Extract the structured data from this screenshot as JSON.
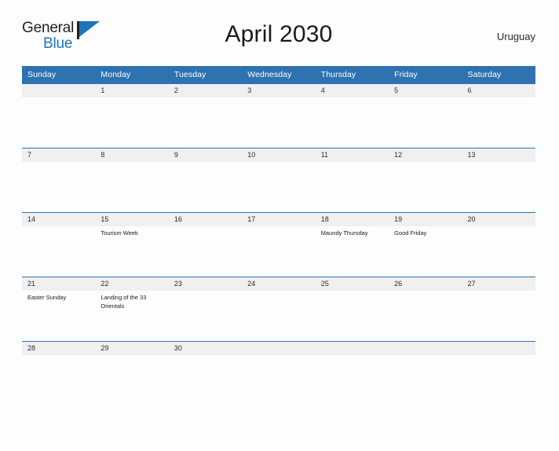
{
  "logo": {
    "line1": "General",
    "line2": "Blue",
    "flag_icon": "flag-triangle-icon",
    "color_dark": "#231f20",
    "color_blue": "#1b75bb"
  },
  "header": {
    "title": "April 2030",
    "country": "Uruguay"
  },
  "colors": {
    "header_blue": "#2e72b0",
    "daynum_band": "#f0f0f0",
    "page_background": "#fdfdfd",
    "text": "#1a1a1a"
  },
  "calendar": {
    "weekday_headers": [
      "Sunday",
      "Monday",
      "Tuesday",
      "Wednesday",
      "Thursday",
      "Friday",
      "Saturday"
    ],
    "weeks": [
      [
        {
          "day": "",
          "events": []
        },
        {
          "day": "1",
          "events": []
        },
        {
          "day": "2",
          "events": []
        },
        {
          "day": "3",
          "events": []
        },
        {
          "day": "4",
          "events": []
        },
        {
          "day": "5",
          "events": []
        },
        {
          "day": "6",
          "events": []
        }
      ],
      [
        {
          "day": "7",
          "events": []
        },
        {
          "day": "8",
          "events": []
        },
        {
          "day": "9",
          "events": []
        },
        {
          "day": "10",
          "events": []
        },
        {
          "day": "11",
          "events": []
        },
        {
          "day": "12",
          "events": []
        },
        {
          "day": "13",
          "events": []
        }
      ],
      [
        {
          "day": "14",
          "events": []
        },
        {
          "day": "15",
          "events": [
            "Tourism Week"
          ]
        },
        {
          "day": "16",
          "events": []
        },
        {
          "day": "17",
          "events": []
        },
        {
          "day": "18",
          "events": [
            "Maundy Thursday"
          ]
        },
        {
          "day": "19",
          "events": [
            "Good Friday"
          ]
        },
        {
          "day": "20",
          "events": []
        }
      ],
      [
        {
          "day": "21",
          "events": [
            "Easter Sunday"
          ]
        },
        {
          "day": "22",
          "events": [
            "Landing of the 33 Orientals"
          ]
        },
        {
          "day": "23",
          "events": []
        },
        {
          "day": "24",
          "events": []
        },
        {
          "day": "25",
          "events": []
        },
        {
          "day": "26",
          "events": []
        },
        {
          "day": "27",
          "events": []
        }
      ],
      [
        {
          "day": "28",
          "events": []
        },
        {
          "day": "29",
          "events": []
        },
        {
          "day": "30",
          "events": []
        },
        {
          "day": "",
          "events": []
        },
        {
          "day": "",
          "events": []
        },
        {
          "day": "",
          "events": []
        },
        {
          "day": "",
          "events": []
        }
      ]
    ]
  }
}
